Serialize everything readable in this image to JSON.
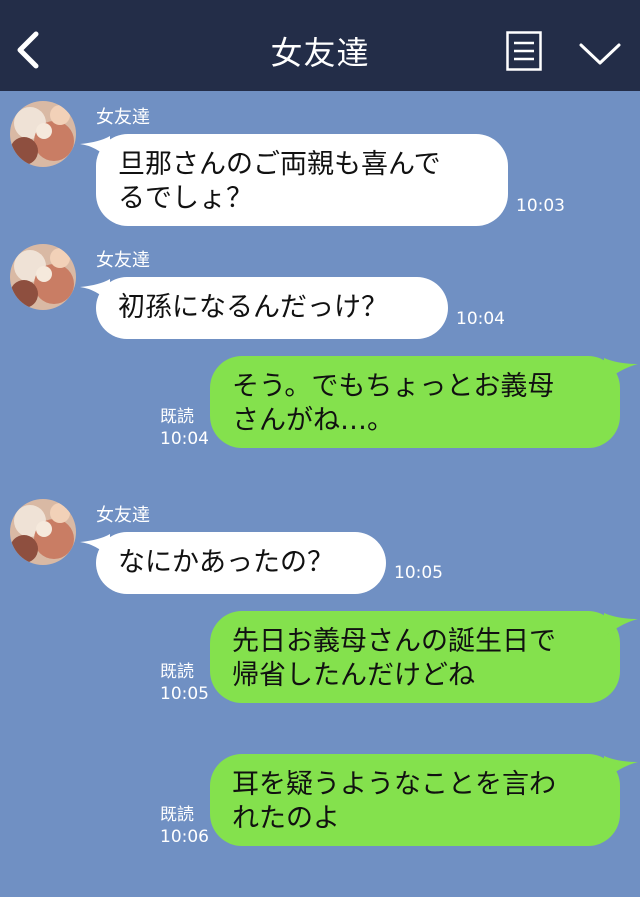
{
  "header": {
    "title": "女友達"
  },
  "messages": [
    {
      "side": "in",
      "sender": "女友達",
      "lines": [
        "旦那さんのご両親も喜んで",
        "るでしょ？"
      ],
      "time": "10:03"
    },
    {
      "side": "in",
      "sender": "女友達",
      "lines": [
        "初孫になるんだっけ？"
      ],
      "time": "10:04"
    },
    {
      "side": "out",
      "lines": [
        "そう。でもちょっとお義母",
        "さんがね…。"
      ],
      "read": "既読",
      "time": "10:04"
    },
    {
      "side": "in",
      "sender": "女友達",
      "lines": [
        "なにかあったの？"
      ],
      "time": "10:05"
    },
    {
      "side": "out",
      "lines": [
        "先日お義母さんの誕生日で",
        "帰省したんだけどね"
      ],
      "read": "既読",
      "time": "10:05"
    },
    {
      "side": "out",
      "lines": [
        "耳を疑うようなことを言わ",
        "れたのよ"
      ],
      "read": "既読",
      "time": "10:06"
    }
  ],
  "colors": {
    "header_bg": "#232d48",
    "chat_bg": "#7090c3",
    "incoming_bubble": "#ffffff",
    "outgoing_bubble": "#84e14d"
  },
  "icons": [
    "back-chevron-icon",
    "menu-list-icon",
    "chevron-down-icon",
    "avatar"
  ]
}
